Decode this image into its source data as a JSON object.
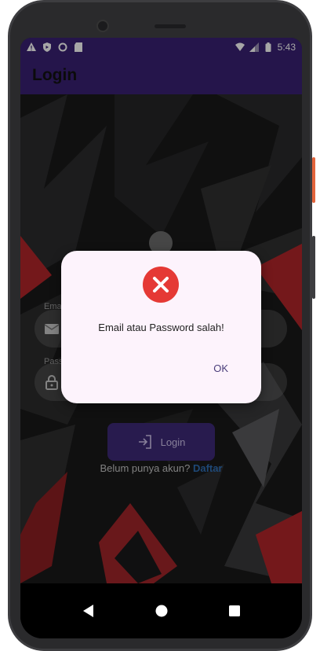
{
  "status_bar": {
    "time": "5:43",
    "left_icons": [
      "warning-icon",
      "shield-icon",
      "record-icon",
      "sd-card-icon"
    ],
    "right_icons": [
      "wifi-icon",
      "signal-icon",
      "battery-icon"
    ]
  },
  "app_bar": {
    "title": "Login"
  },
  "form": {
    "email_label": "Ema",
    "password_label": "Pass",
    "login_button": "Login",
    "register_prompt": "Belum punya akun?",
    "register_link": "Daftar"
  },
  "dialog": {
    "icon": "error-x-icon",
    "message": "Email atau Password salah!",
    "ok_button": "OK"
  },
  "colors": {
    "primary": "#3a2173",
    "error": "#e53935",
    "link": "#2f6fb6"
  }
}
